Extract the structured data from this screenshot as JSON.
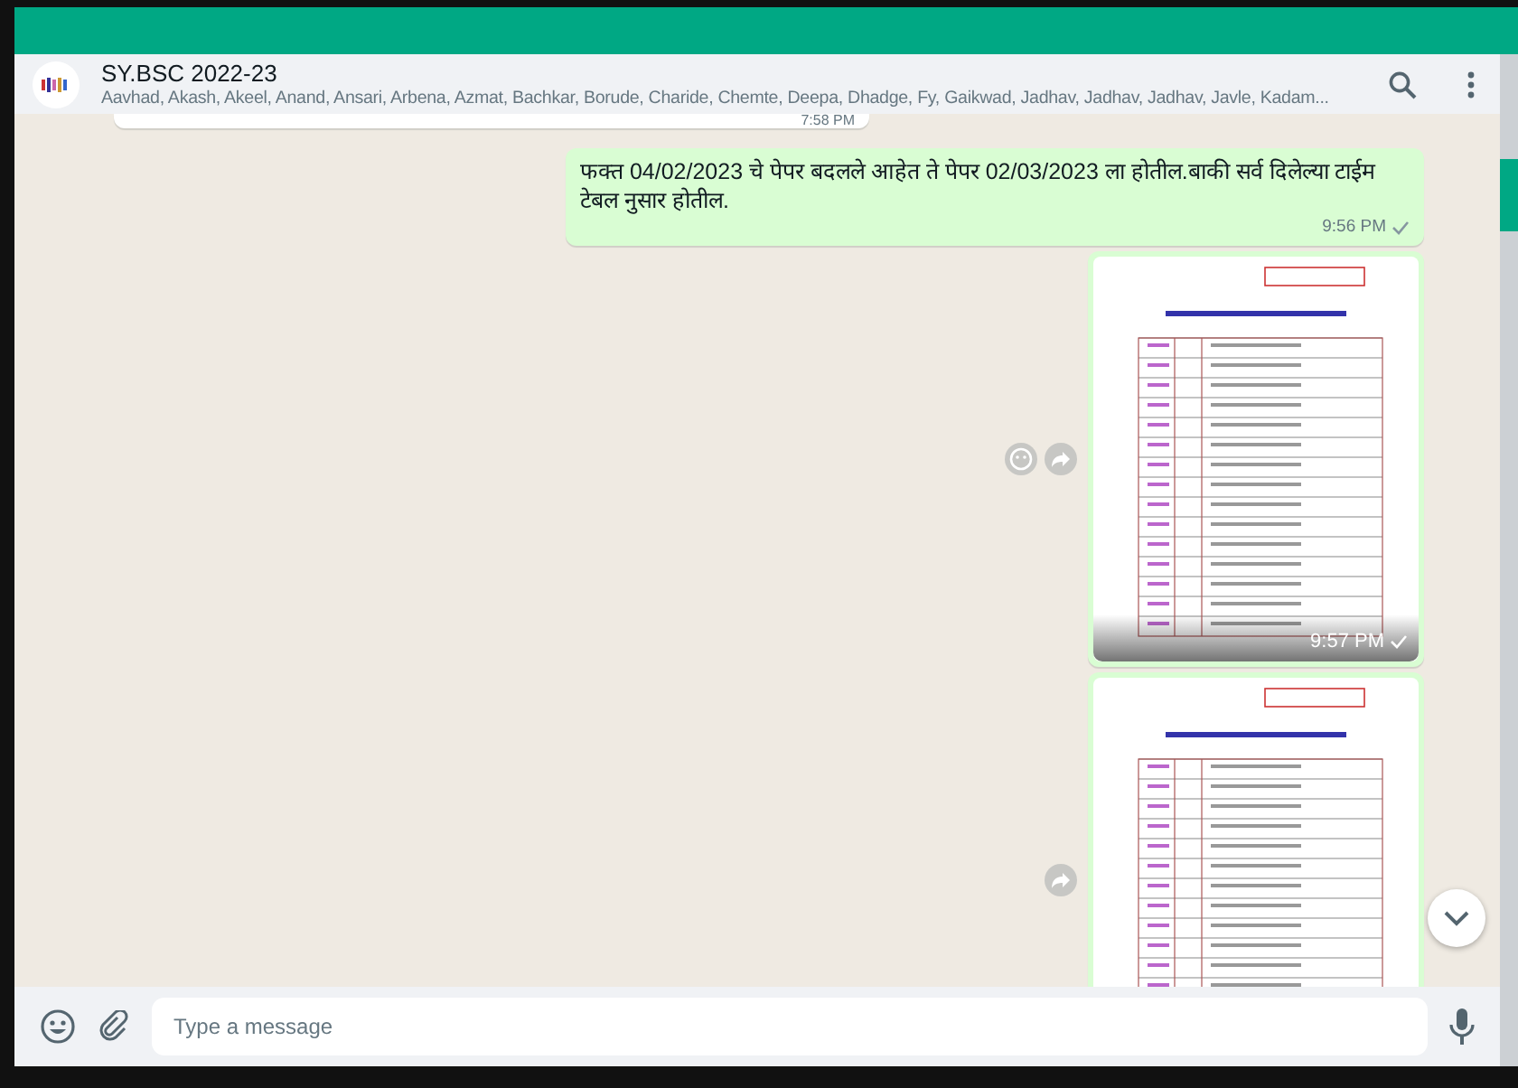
{
  "header": {
    "title": "SY.BSC 2022-23",
    "members": "Aavhad, Akash, Akeel, Anand, Ansari, Arbena, Azmat, Bachkar, Borude, Charide, Chemte, Deepa, Dhadge, Fy, Gaikwad, Jadhav, Jadhav, Jadhav, Javle, Kadam..."
  },
  "messages": [
    {
      "kind": "partial",
      "outgoing": false,
      "time": "7:58 PM"
    },
    {
      "kind": "text",
      "outgoing": true,
      "text": "फक्त 04/02/2023 चे पेपर बदलले आहेत  ते पेपर 02/03/2023 ला होतील.बाकी सर्व दिलेल्या टाईम टेबल नुसार होतील.",
      "time": "9:56 PM",
      "sent": true
    },
    {
      "kind": "image",
      "outgoing": true,
      "time": "9:57 PM",
      "sent": true,
      "emoji_button": true,
      "forward_button": true
    },
    {
      "kind": "image",
      "outgoing": true,
      "emoji_button": false,
      "forward_button": true
    }
  ],
  "composer": {
    "placeholder": "Type a message"
  }
}
